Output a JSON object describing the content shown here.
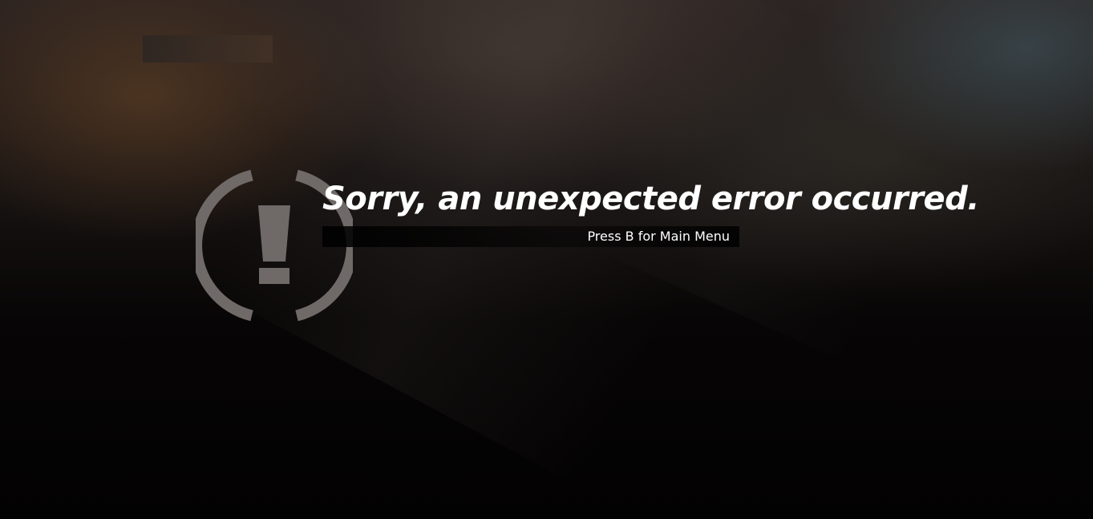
{
  "error_screen": {
    "headline": "Sorry, an unexpected error occurred.",
    "prompt": "Press B for Main Menu"
  },
  "icons": {
    "alert": "exclamation-circle-icon"
  },
  "colors": {
    "text": "#ffffff",
    "icon": "#6f6a67",
    "background": "#050404"
  }
}
